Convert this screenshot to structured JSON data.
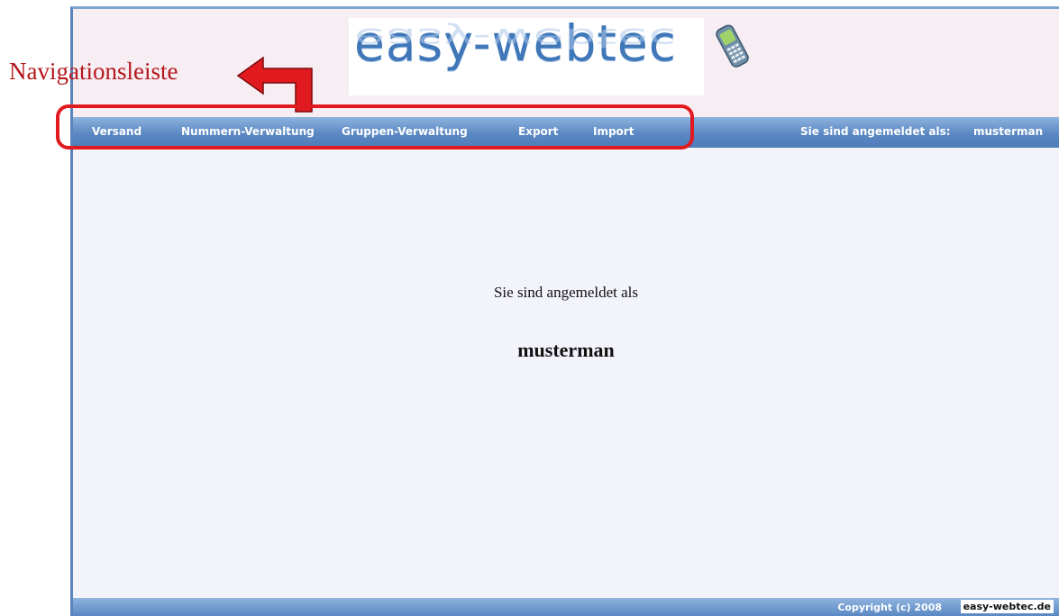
{
  "header": {
    "logo_text": "easy-webtec",
    "phone_icon": "mobile-phone-icon"
  },
  "nav": {
    "items": [
      {
        "label": "Versand"
      },
      {
        "label": "Nummern-Verwaltung"
      },
      {
        "label": "Gruppen-Verwaltung"
      },
      {
        "label": "Export"
      },
      {
        "label": "Import"
      }
    ],
    "user_label": "Sie sind angemeldet als:",
    "user_name": "musterman"
  },
  "main": {
    "welcome_text": "Sie sind angemeldet als",
    "welcome_user": "musterman"
  },
  "footer": {
    "copyright": "Copyright (c) 2008",
    "brand": "easy-webtec.de"
  },
  "annotation": {
    "label": "Navigationsleiste",
    "arrow_icon": "arrow-left-icon",
    "color": "#e01a1f"
  },
  "colors": {
    "nav_bar": "#5a88c3",
    "logo": "#3f77b8",
    "content_bg": "#f2f3fb"
  }
}
